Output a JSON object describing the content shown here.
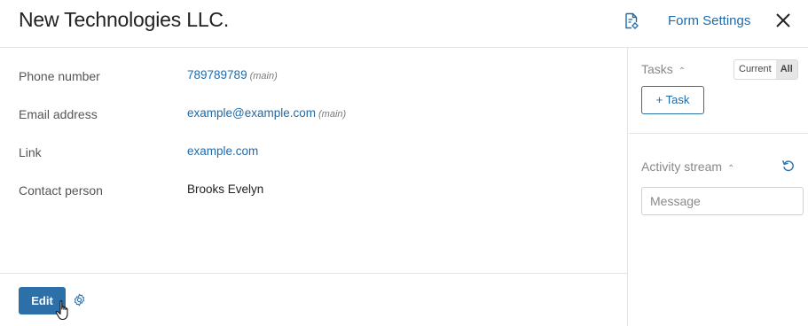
{
  "header": {
    "title": "New Technologies LLC.",
    "form_settings_label": "Form Settings",
    "doc_icon": "document-settings-icon",
    "close_icon": "close-icon"
  },
  "fields": [
    {
      "label": "Phone number",
      "value": "789789789",
      "tag": "(main)"
    },
    {
      "label": "Email address",
      "value": "example@example.com",
      "tag": "(main)"
    },
    {
      "label": "Link",
      "value": "example.com",
      "tag": ""
    },
    {
      "label": "Contact person",
      "value": "Brooks Evelyn",
      "tag": ""
    }
  ],
  "footer": {
    "edit_label": "Edit",
    "gear_icon": "gear-icon"
  },
  "sidebar": {
    "tasks_label": "Tasks",
    "toggle_current": "Current",
    "toggle_all": "All",
    "toggle_selected": "All",
    "add_task_label": "+ Task",
    "activity_label": "Activity stream",
    "message_placeholder": "Message"
  },
  "colors": {
    "accent": "#2d6fa8",
    "link": "#1f6aa8",
    "border": "#e3e3e3"
  }
}
